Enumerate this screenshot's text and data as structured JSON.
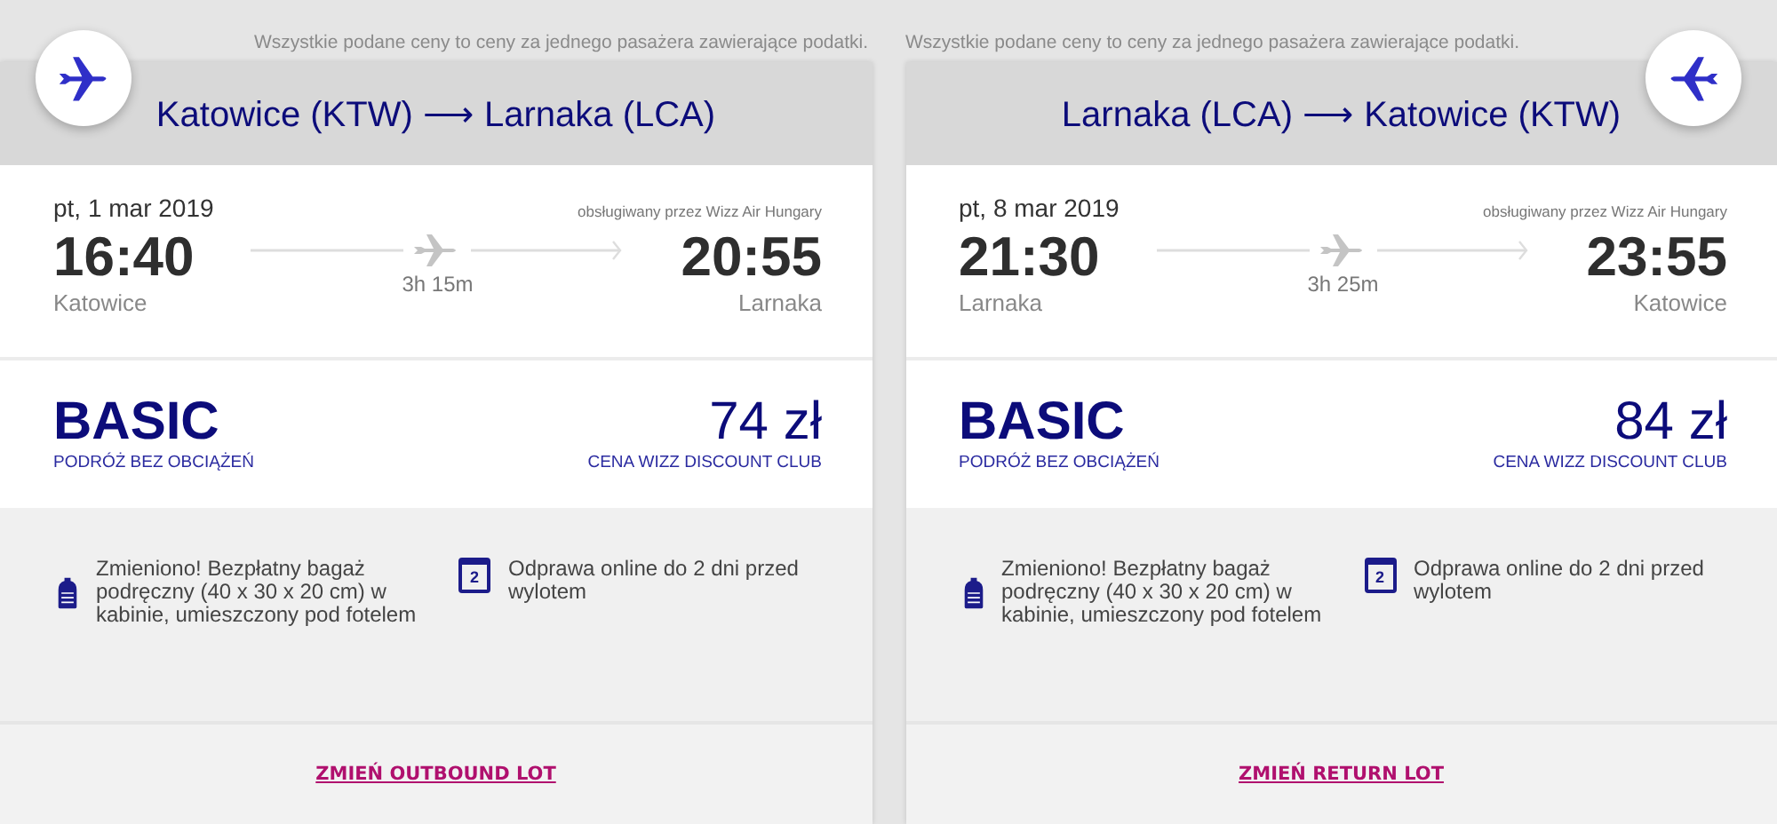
{
  "cards": [
    {
      "kind": "outbound",
      "notice": "Wszystkie podane ceny to ceny za jednego pasażera zawierające podatki.",
      "route": "Katowice (KTW) ⟶ Larnaka (LCA)",
      "date": "pt, 1 mar 2019",
      "operator": "obsługiwany przez Wizz Air Hungary",
      "departure_time": "16:40",
      "departure_city": "Katowice",
      "duration": "3h 15m",
      "arrival_time": "20:55",
      "arrival_city": "Larnaka",
      "fare": "BASIC",
      "fare_subtitle": "PODRÓŻ BEZ OBCIĄŻEŃ",
      "price": "74 zł",
      "price_note": "CENA WIZZ DISCOUNT CLUB",
      "features": [
        {
          "kind": "bag",
          "text": "Zmieniono! Bezpłatny bagaż podręczny (40 x 30 x 20 cm) w kabinie, umieszczony pod fotelem"
        },
        {
          "kind": "calendar",
          "icon_text": "2",
          "text": "Odprawa online do 2 dni przed wylotem"
        }
      ],
      "change_link": "ZMIEŃ OUTBOUND LOT"
    },
    {
      "kind": "return",
      "notice": "Wszystkie podane ceny to ceny za jednego pasażera zawierające podatki.",
      "route": "Larnaka (LCA) ⟶ Katowice (KTW)",
      "date": "pt, 8 mar 2019",
      "operator": "obsługiwany przez Wizz Air Hungary",
      "departure_time": "21:30",
      "departure_city": "Larnaka",
      "duration": "3h 25m",
      "arrival_time": "23:55",
      "arrival_city": "Katowice",
      "fare": "BASIC",
      "fare_subtitle": "PODRÓŻ BEZ OBCIĄŻEŃ",
      "price": "84 zł",
      "price_note": "CENA WIZZ DISCOUNT CLUB",
      "features": [
        {
          "kind": "bag",
          "text": "Zmieniono! Bezpłatny bagaż podręczny (40 x 30 x 20 cm) w kabinie, umieszczony pod fotelem"
        },
        {
          "kind": "calendar",
          "icon_text": "2",
          "text": "Odprawa online do 2 dni przed wylotem"
        }
      ],
      "change_link": "ZMIEŃ RETURN LOT"
    }
  ]
}
